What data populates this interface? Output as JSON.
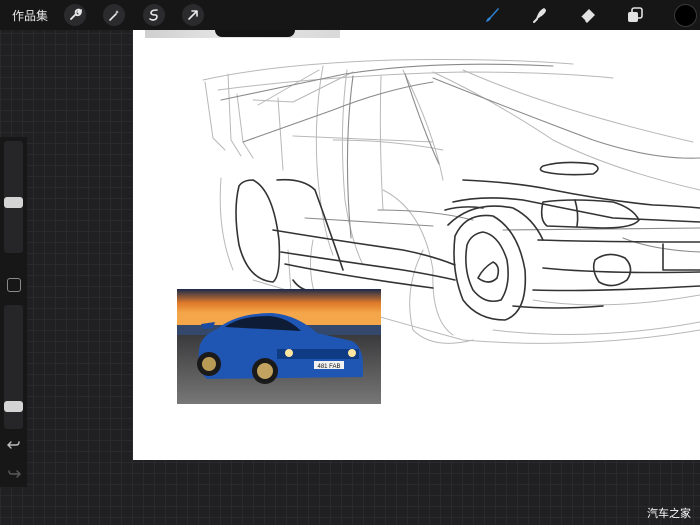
{
  "topbar": {
    "gallery_label": "作品集",
    "left_tools": [
      {
        "icon": "wrench-icon",
        "name": "actions"
      },
      {
        "icon": "magic-wand-icon",
        "name": "adjustments"
      },
      {
        "icon": "selection-icon",
        "name": "selection"
      },
      {
        "icon": "arrow-cursor-icon",
        "name": "transform"
      }
    ],
    "right_tools": [
      {
        "icon": "brush-icon",
        "name": "brush",
        "active": true
      },
      {
        "icon": "smudge-icon",
        "name": "smudge"
      },
      {
        "icon": "eraser-icon",
        "name": "eraser"
      },
      {
        "icon": "layers-icon",
        "name": "layers"
      }
    ],
    "current_color": "#000000",
    "active_color": "#2f86d8"
  },
  "sidebar": {
    "brush_size_level": 0.45,
    "opacity_level": 0.15
  },
  "reference_photo": {
    "plate_text": "481 FAB"
  },
  "watermark": "汽车之家"
}
